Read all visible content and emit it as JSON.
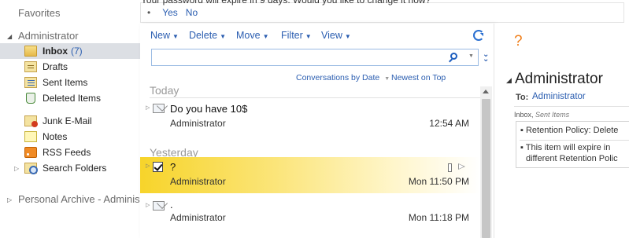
{
  "nav": {
    "favorites_label": "Favorites",
    "account_label": "Administrator",
    "folders": [
      {
        "name": "inbox",
        "label": "Inbox",
        "count": "(7)",
        "icon": "inbox-icon"
      },
      {
        "name": "drafts",
        "label": "Drafts",
        "icon": "drafts-icon"
      },
      {
        "name": "sent-items",
        "label": "Sent Items",
        "icon": "sent-items-icon"
      },
      {
        "name": "deleted-items",
        "label": "Deleted Items",
        "icon": "deleted-items-icon"
      },
      {
        "name": "junk-email",
        "label": "Junk E-Mail",
        "icon": "junk-email-icon"
      },
      {
        "name": "notes",
        "label": "Notes",
        "icon": "notes-icon"
      },
      {
        "name": "rss-feeds",
        "label": "RSS Feeds",
        "icon": "rss-feeds-icon"
      },
      {
        "name": "search-folders",
        "label": "Search Folders",
        "icon": "search-folders-icon"
      }
    ],
    "archive_label": "Personal Archive - Adminis"
  },
  "infobar": {
    "message": "Your password will expire in 9 days. Would you like to change it now?",
    "yes_label": "Yes",
    "no_label": "No"
  },
  "toolbar": {
    "new_label": "New",
    "delete_label": "Delete",
    "move_label": "Move",
    "filter_label": "Filter",
    "view_label": "View"
  },
  "search": {
    "value": "",
    "placeholder": ""
  },
  "sort": {
    "arrange_label": "Conversations by Date",
    "order_label": "Newest on Top"
  },
  "groups": {
    "today_label": "Today",
    "yesterday_label": "Yesterday"
  },
  "messages": [
    {
      "subject": "Do you have 10$",
      "from": "Administrator",
      "time": "12:54 AM",
      "selected": false
    },
    {
      "subject": "?",
      "from": "Administrator",
      "time": "Mon 11:50 PM",
      "selected": true
    },
    {
      "subject": ".",
      "from": "Administrator",
      "time": "Mon 11:18 PM",
      "selected": false
    }
  ],
  "reading_pane": {
    "mark": "?",
    "title": "Administrator",
    "to_label": "To:",
    "to_value": "Administrator",
    "folder": "Inbox,",
    "folder_sub": "Sent Items",
    "policy_line": "Retention Policy: Delete",
    "expire_line1": "This item will expire in",
    "expire_line2": "different Retention Polic"
  },
  "colors": {
    "link_blue": "#2a5db0",
    "selection_yellow": "#f7d42a",
    "accent_orange": "#f07f1a",
    "nav_selected": "#dcdfe4"
  }
}
